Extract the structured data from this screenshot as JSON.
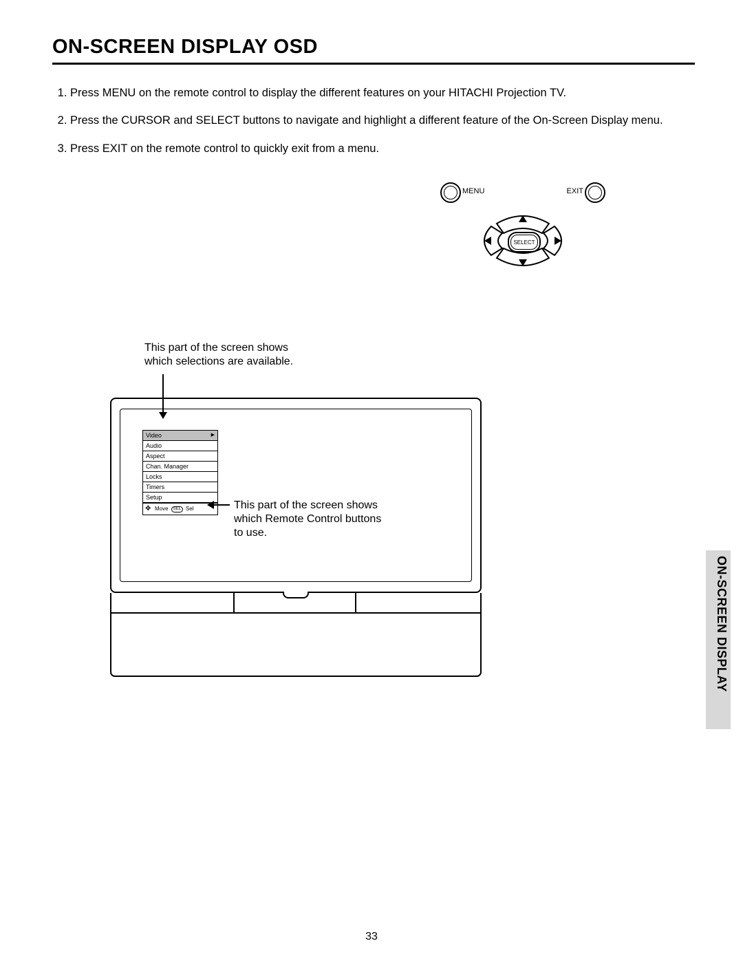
{
  "title": "ON-SCREEN DISPLAY OSD",
  "steps": [
    "Press MENU on the remote control to display the different features on your HITACHI Projection TV.",
    "Press the CURSOR and SELECT buttons to navigate and highlight a different feature of the On-Screen Display menu.",
    "Press EXIT on the remote control to quickly exit from a menu."
  ],
  "remote": {
    "menu_label": "MENU",
    "exit_label": "EXIT",
    "select_label": "SELECT"
  },
  "annot1_line1": "This part of the screen shows",
  "annot1_line2": "which selections are available.",
  "annot2_line1": "This part of the screen shows",
  "annot2_line2": "which Remote Control buttons",
  "annot2_line3": "to use.",
  "osd_menu": {
    "items": [
      "Video",
      "Audio",
      "Aspect",
      "Chan. Manager",
      "Locks",
      "Timers",
      "Setup"
    ],
    "hint_move": "Move",
    "hint_sel_pill": "SEL",
    "hint_sel": "Sel"
  },
  "sidetab": "ON-SCREEN DISPLAY",
  "page_number": "33"
}
